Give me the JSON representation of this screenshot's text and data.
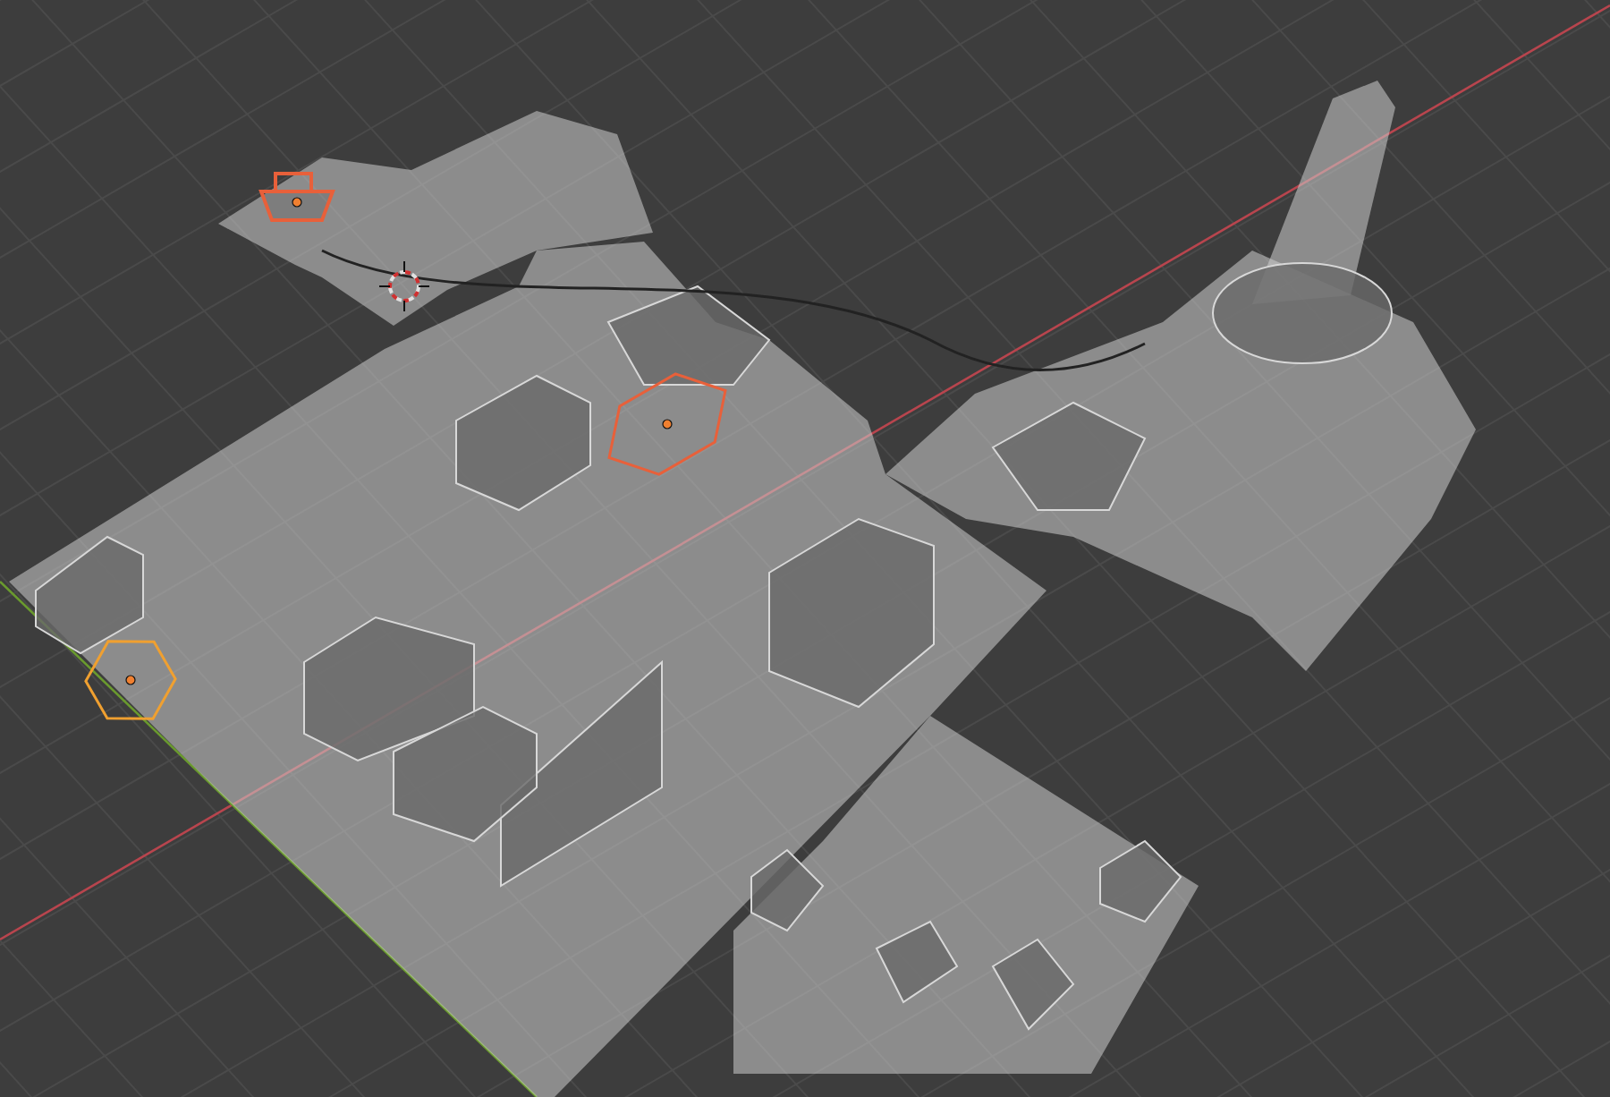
{
  "scene_objects": [
    {
      "kind": "camera",
      "selected": true,
      "active": false
    },
    {
      "kind": "light",
      "selected": true,
      "active": false
    },
    {
      "kind": "light",
      "selected": true,
      "active": true
    }
  ]
}
